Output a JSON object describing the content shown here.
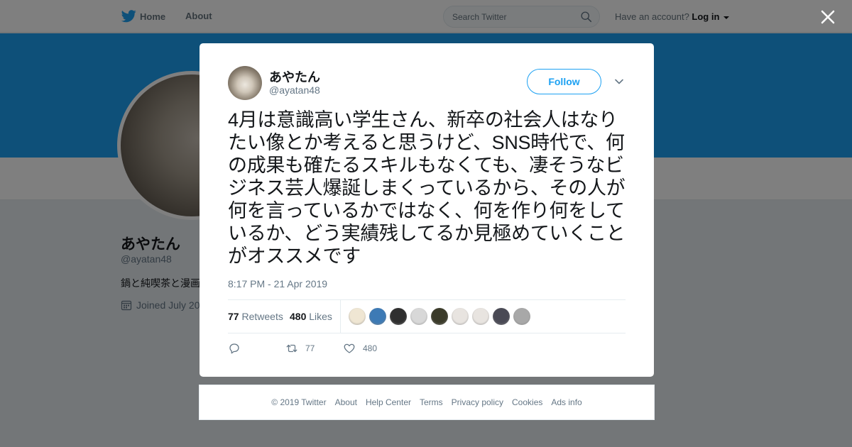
{
  "topbar": {
    "home_label": "Home",
    "about_label": "About",
    "search_placeholder": "Search Twitter",
    "account_prompt": "Have an account?",
    "login_label": "Log in"
  },
  "profile": {
    "name": "あやたん",
    "handle": "@ayatan48",
    "bio": "鍋と純喫茶と漫画",
    "joined": "Joined July 20"
  },
  "tweet": {
    "author_name": "あやたん",
    "author_handle": "@ayatan48",
    "follow_label": "Follow",
    "text": "4月は意識高い学生さん、新卒の社会人はなりたい像とか考えると思うけど、SNS時代で、何の成果も確たるスキルもなくても、凄そうなビジネス芸人爆誕しまくっているから、その人が何を言っているかではなく、何を作り何をしているか、どう実績残してるか見極めていくことがオススメです",
    "timestamp": "8:17 PM - 21 Apr 2019",
    "retweets_count": "77",
    "retweets_label": "Retweets",
    "likes_count": "480",
    "likes_label": "Likes",
    "action_retweet_count": "77",
    "action_like_count": "480"
  },
  "liker_colors": [
    "#efe6d3",
    "#3d7ab5",
    "#2f2f2f",
    "#d8d8d8",
    "#3b3b2a",
    "#e8e4e0",
    "#e8e4e0",
    "#4a4a55",
    "#a8a8a8"
  ],
  "footer": {
    "links": [
      "© 2019 Twitter",
      "About",
      "Help Center",
      "Terms",
      "Privacy policy",
      "Cookies",
      "Ads info"
    ]
  },
  "colors": {
    "brand": "#1da1f2",
    "overlay": "rgba(0,0,0,0.5)",
    "muted": "#657786"
  }
}
